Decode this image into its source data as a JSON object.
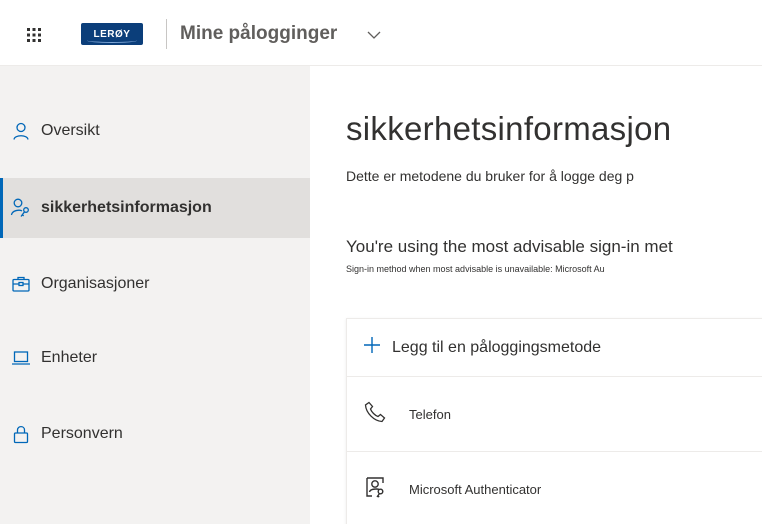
{
  "header": {
    "logo_text": "LERØY",
    "app_title": "Mine pålogginger"
  },
  "sidebar": {
    "items": [
      {
        "label": "Oversikt",
        "icon": "person-icon",
        "active": false
      },
      {
        "label": "sikkerhetsinformasjon",
        "icon": "person-key-icon",
        "active": true
      },
      {
        "label": "Organisasjoner",
        "icon": "briefcase-icon",
        "active": false
      },
      {
        "label": "Enheter",
        "icon": "laptop-icon",
        "active": false
      },
      {
        "label": "Personvern",
        "icon": "lock-icon",
        "active": false
      }
    ]
  },
  "main": {
    "title": "sikkerhetsinformasjon",
    "description": "Dette er metodene du bruker for å logge deg p",
    "advisable": "You're using the most advisable sign-in met",
    "advisable_sub": "Sign-in method when most advisable is unavailable: Microsoft Au",
    "add_method_label": "Legg til en påloggingsmetode",
    "methods": [
      {
        "label": "Telefon",
        "icon": "phone-icon"
      },
      {
        "label": "Microsoft Authenticator",
        "icon": "authenticator-icon"
      }
    ]
  },
  "colors": {
    "accent": "#0067b8",
    "sidebar_bg": "#f3f2f1",
    "active_item_bg": "#e1dfdd",
    "logo_bg": "#0b3e7a"
  }
}
